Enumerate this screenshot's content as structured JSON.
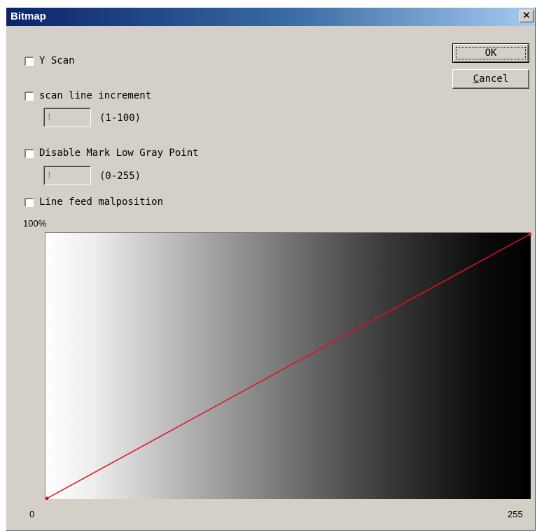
{
  "window": {
    "title": "Bitmap",
    "close_glyph": "✕"
  },
  "options": {
    "y_scan": {
      "label": "Y Scan",
      "checked": false
    },
    "scan_line_increment": {
      "label": "scan line increment",
      "checked": false,
      "value": "1",
      "range": "(1-100)"
    },
    "disable_low_gray": {
      "label": "Disable Mark Low Gray Point",
      "checked": false,
      "value": "1",
      "range": "(0-255)"
    },
    "line_feed": {
      "label": "Line feed malposition",
      "checked": false
    }
  },
  "buttons": {
    "ok": "OK",
    "cancel_prefix": "C",
    "cancel_rest": "ancel"
  },
  "curve": {
    "y_max_label": "100%",
    "x_min_label": "0",
    "x_max_label": "255",
    "line_color": "#e01020",
    "points": [
      [
        0,
        0
      ],
      [
        255,
        100
      ]
    ]
  }
}
